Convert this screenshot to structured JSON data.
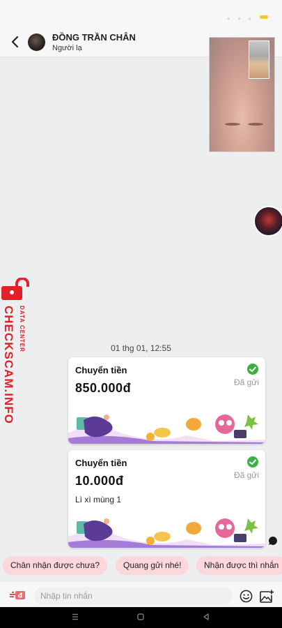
{
  "header": {
    "contact_name": "ĐỒNG TRẦN CHÂN",
    "contact_status": "Người lạ"
  },
  "watermark": {
    "main": "CHECKSCAM.INFO",
    "sub": "DATA CENTER"
  },
  "chat": {
    "timestamp": "01 thg 01, 12:55",
    "messages": [
      {
        "title": "Chuyển tiền",
        "amount": "850.000đ",
        "status": "Đã gửi",
        "note": ""
      },
      {
        "title": "Chuyển tiền",
        "amount": "10.000đ",
        "status": "Đã gửi",
        "note": "Lì xì mùng 1"
      }
    ]
  },
  "suggestions": [
    "Chân nhận được chưa?",
    "Quang gửi nhé!",
    "Nhận được thì nhắn"
  ],
  "input": {
    "placeholder": "Nhập tin nhắn",
    "money_badge": "đ"
  },
  "icons": {
    "back": "arrow-left-icon",
    "check": "check-circle-icon",
    "emoji": "smiley-icon",
    "image": "image-add-icon",
    "money": "money-transfer-icon"
  },
  "colors": {
    "accent_red": "#e2202a",
    "chip_bg": "#fdd7db",
    "check_green": "#3cb043",
    "battery": "#f5c63c"
  }
}
